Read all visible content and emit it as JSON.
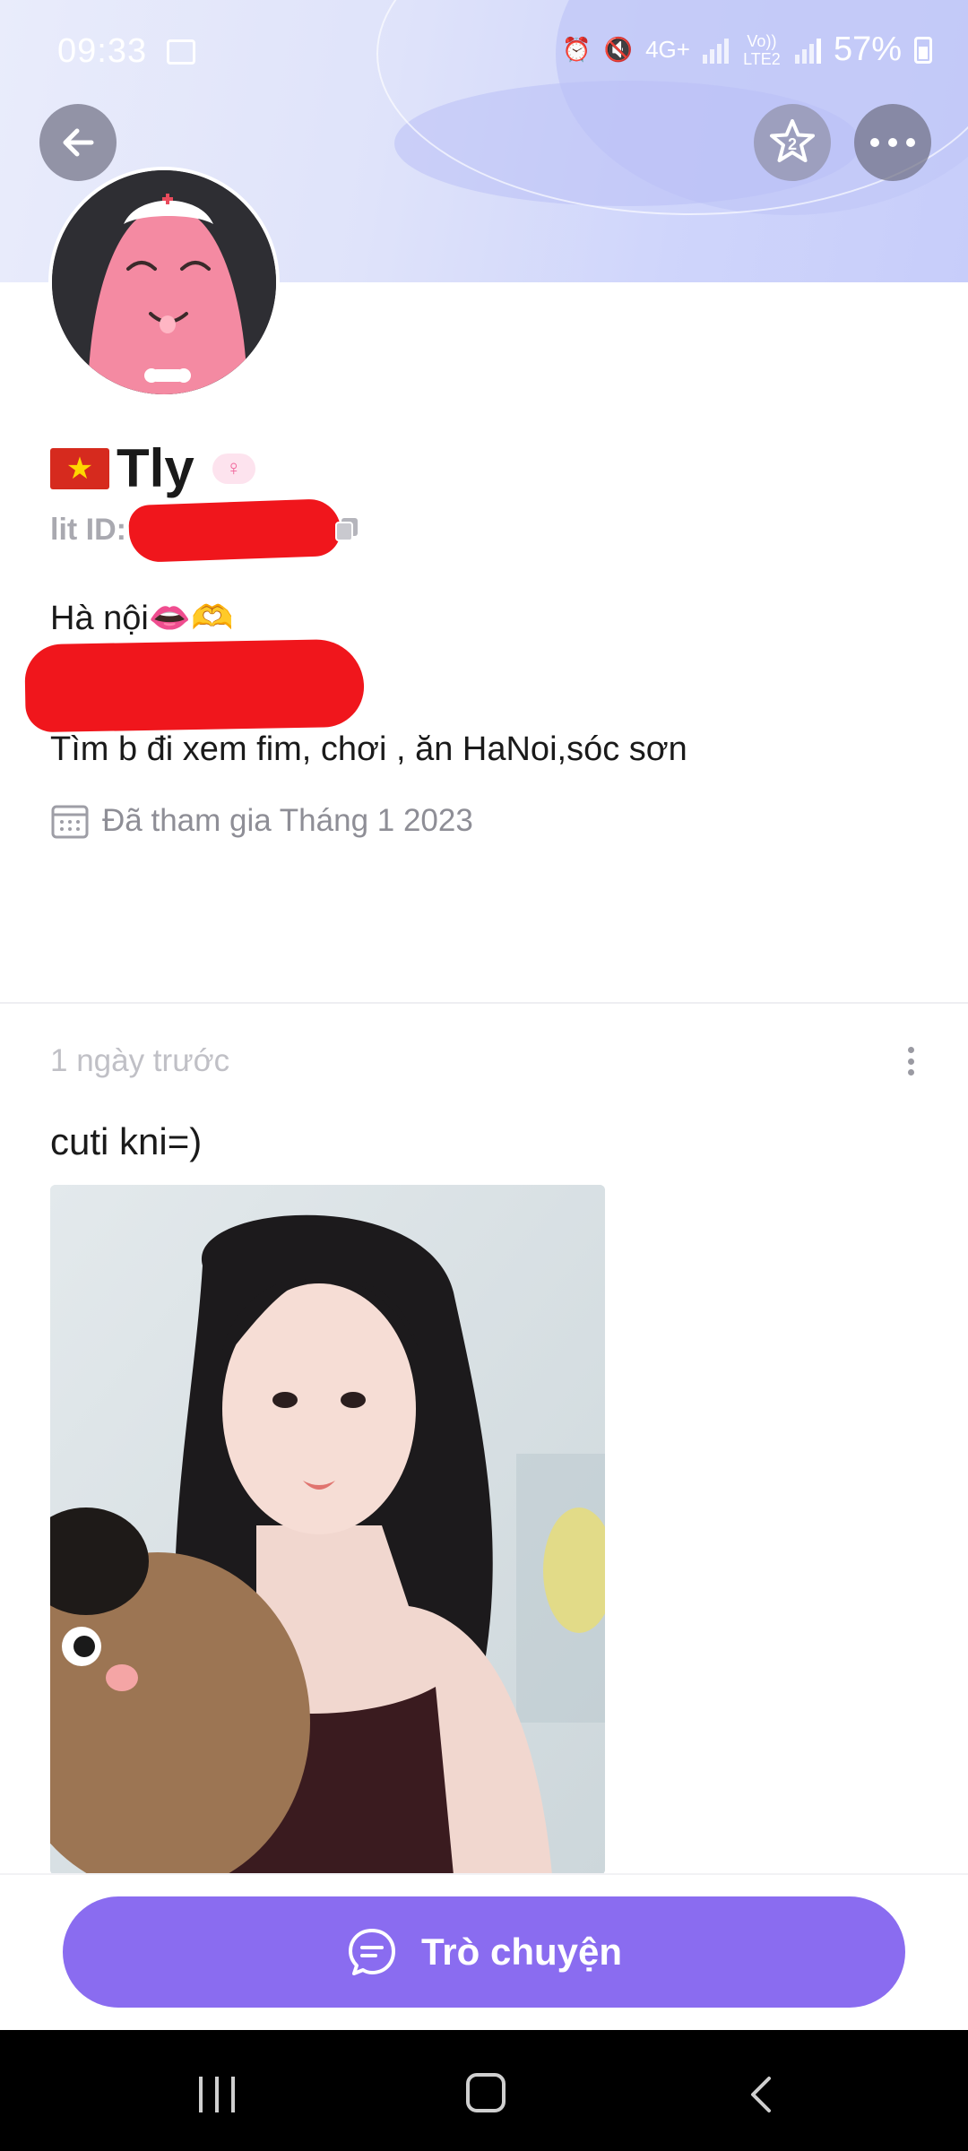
{
  "status_bar": {
    "time": "09:33",
    "network": "4G+",
    "carrier": "Vo)) LTE2",
    "battery": "57%"
  },
  "header": {
    "star_count": "2"
  },
  "profile": {
    "name": "Tly",
    "lit_id_label": "lit ID:",
    "bio_line1": "Hà nội👄🫶",
    "bio_line3": "Tìm b đi xem fim, chơi , ăn HaNoi,sóc sơn",
    "joined": "Đã tham gia Tháng 1 2023"
  },
  "post": {
    "time": "1 ngày trước",
    "text": "cuti kni=)"
  },
  "actions": {
    "chat_label": "Trò chuyện"
  },
  "colors": {
    "accent": "#8a6cf0",
    "redaction": "#f0161c",
    "banner": "#cfd5fb"
  },
  "icons": {
    "back": "arrow-left-icon",
    "star": "star-icon",
    "more": "more-horizontal-icon",
    "copy": "copy-icon",
    "calendar": "calendar-icon",
    "chat": "chat-bubble-icon"
  }
}
